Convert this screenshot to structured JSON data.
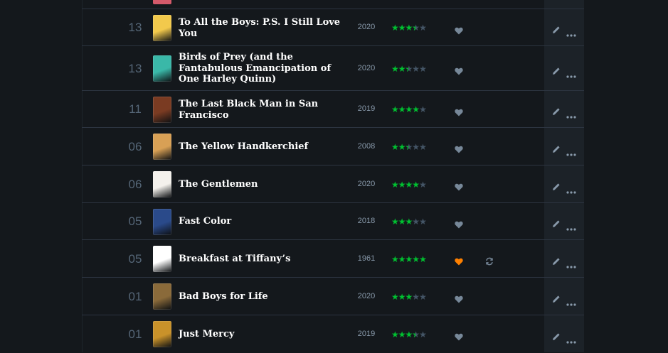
{
  "colors": {
    "background": "#14181c",
    "row_border": "#2c3440",
    "star_green": "#00c030",
    "star_empty": "#445566",
    "heart_liked": "#ff8000",
    "heart_unliked": "#778899"
  },
  "diary": {
    "entries": [
      {
        "day": "13",
        "title": "To All the Boys: P.S. I Still Love You",
        "year": "2020",
        "rating": 3.5,
        "liked": false,
        "rewatch": false,
        "poster_color": "#f2c94c"
      },
      {
        "day": "13",
        "title": "Birds of Prey (and the Fantabulous Emancipation of One Harley Quinn)",
        "year": "2020",
        "rating": 2.5,
        "liked": false,
        "rewatch": false,
        "poster_color": "#3ab8a8"
      },
      {
        "day": "11",
        "title": "The Last Black Man in San Francisco",
        "year": "2019",
        "rating": 4,
        "liked": false,
        "rewatch": false,
        "poster_color": "#7a3b22"
      },
      {
        "day": "06",
        "title": "The Yellow Handkerchief",
        "year": "2008",
        "rating": 2.5,
        "liked": false,
        "rewatch": false,
        "poster_color": "#d8a055"
      },
      {
        "day": "06",
        "title": "The Gentlemen",
        "year": "2020",
        "rating": 4,
        "liked": false,
        "rewatch": false,
        "poster_color": "#f4f1ec"
      },
      {
        "day": "05",
        "title": "Fast Color",
        "year": "2018",
        "rating": 3,
        "liked": false,
        "rewatch": false,
        "poster_color": "#2a4a8a"
      },
      {
        "day": "05",
        "title": "Breakfast at Tiffany’s",
        "year": "1961",
        "rating": 5,
        "liked": true,
        "rewatch": true,
        "poster_color": "#ffffff"
      },
      {
        "day": "01",
        "title": "Bad Boys for Life",
        "year": "2020",
        "rating": 3,
        "liked": false,
        "rewatch": false,
        "poster_color": "#8a6a3a"
      },
      {
        "day": "01",
        "title": "Just Mercy",
        "year": "2019",
        "rating": 3.5,
        "liked": false,
        "rewatch": false,
        "poster_color": "#c9922a"
      }
    ]
  }
}
